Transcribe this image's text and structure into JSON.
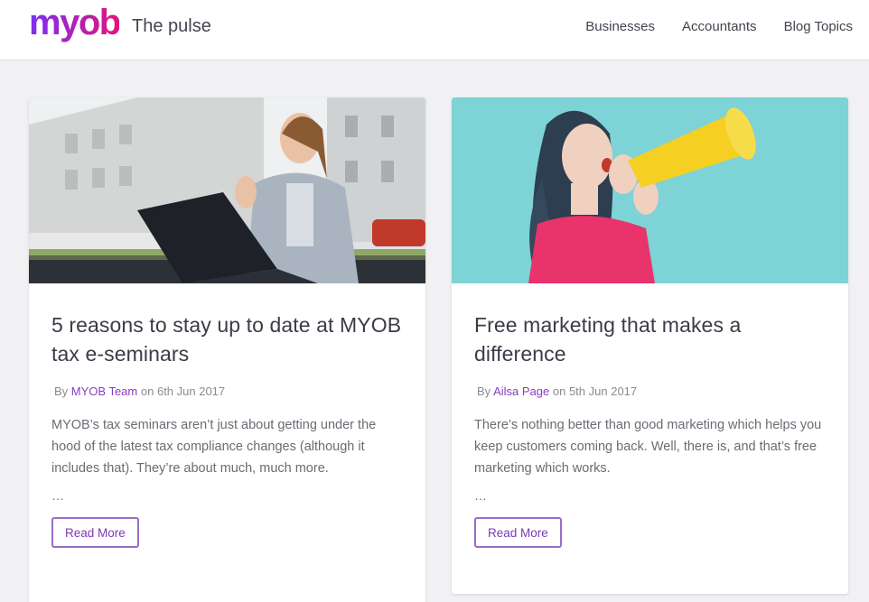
{
  "brand": {
    "logo_text": "myob",
    "site_name": "The pulse",
    "colors": {
      "logo_start": "#7b2ff7",
      "logo_end": "#e0157a",
      "accent": "#8a3dbf",
      "button_border": "#9b6cc9"
    }
  },
  "nav": {
    "items": [
      {
        "label": "Businesses"
      },
      {
        "label": "Accountants"
      },
      {
        "label": "Blog Topics"
      }
    ]
  },
  "posts": [
    {
      "image_alt": "woman-laptop-photo",
      "title": "5 reasons to stay up to date at MYOB tax e-seminars",
      "by": "By",
      "author": "MYOB Team",
      "on": "on",
      "date": "6th Jun 2017",
      "excerpt": "MYOB’s tax seminars aren’t just about getting under the hood of the latest tax compliance changes (although it includes that). They’re about much, much more.",
      "ellipsis": "…",
      "button": "Read More"
    },
    {
      "image_alt": "woman-megaphone-photo",
      "title": "Free marketing that makes a difference",
      "by": "By",
      "author": "Ailsa Page",
      "on": "on",
      "date": "5th Jun 2017",
      "excerpt": "There’s nothing better than good marketing which helps you keep customers coming back. Well, there is, and that’s free marketing which works.",
      "ellipsis": "…",
      "button": "Read More"
    }
  ]
}
